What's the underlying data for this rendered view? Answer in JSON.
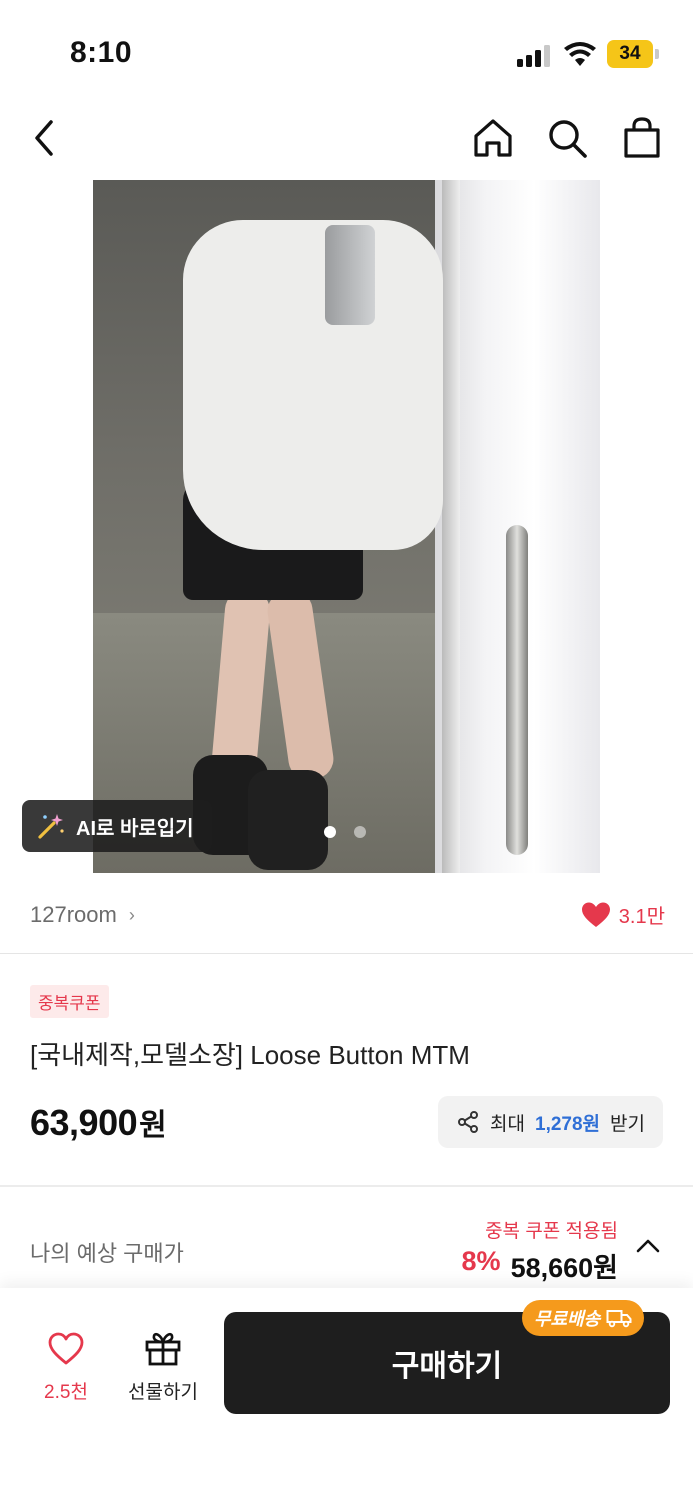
{
  "status_bar": {
    "time": "8:10",
    "battery": "34",
    "icons": [
      "signal-icon",
      "wifi-icon",
      "battery-icon"
    ]
  },
  "nav": {
    "icons": [
      "back-icon",
      "home-icon",
      "search-icon",
      "shopping-bag-icon"
    ]
  },
  "hero": {
    "ai_badge_label": "AI로 바로입기",
    "ai_badge_icon": "magic-wand-icon",
    "page_count": 2,
    "current_page": 1
  },
  "store": {
    "name": "127room",
    "like_count": "3.1만"
  },
  "product": {
    "coupon_tag": "중복쿠폰",
    "title": "[국내제작,모델소장] Loose Button MTM",
    "price": "63,900",
    "price_unit": "원",
    "max_coupon_prefix": "최대",
    "max_coupon_amount": "1,278원",
    "max_coupon_suffix": "받기"
  },
  "estimate": {
    "label": "나의 예상 구매가",
    "applied_text": "중복 쿠폰 적용됨",
    "discount_pct": "8%",
    "price": "58,660원"
  },
  "bottom_bar": {
    "wish_count": "2.5천",
    "gift_label": "선물하기",
    "buy_label": "구매하기",
    "free_shipping": "무료배송"
  },
  "colors": {
    "accent_red": "#e5384c",
    "accent_blue": "#2f6fd6",
    "buy_button": "#1e1e1e",
    "free_ship_badge": "#f59a1c",
    "battery": "#f5c518"
  }
}
